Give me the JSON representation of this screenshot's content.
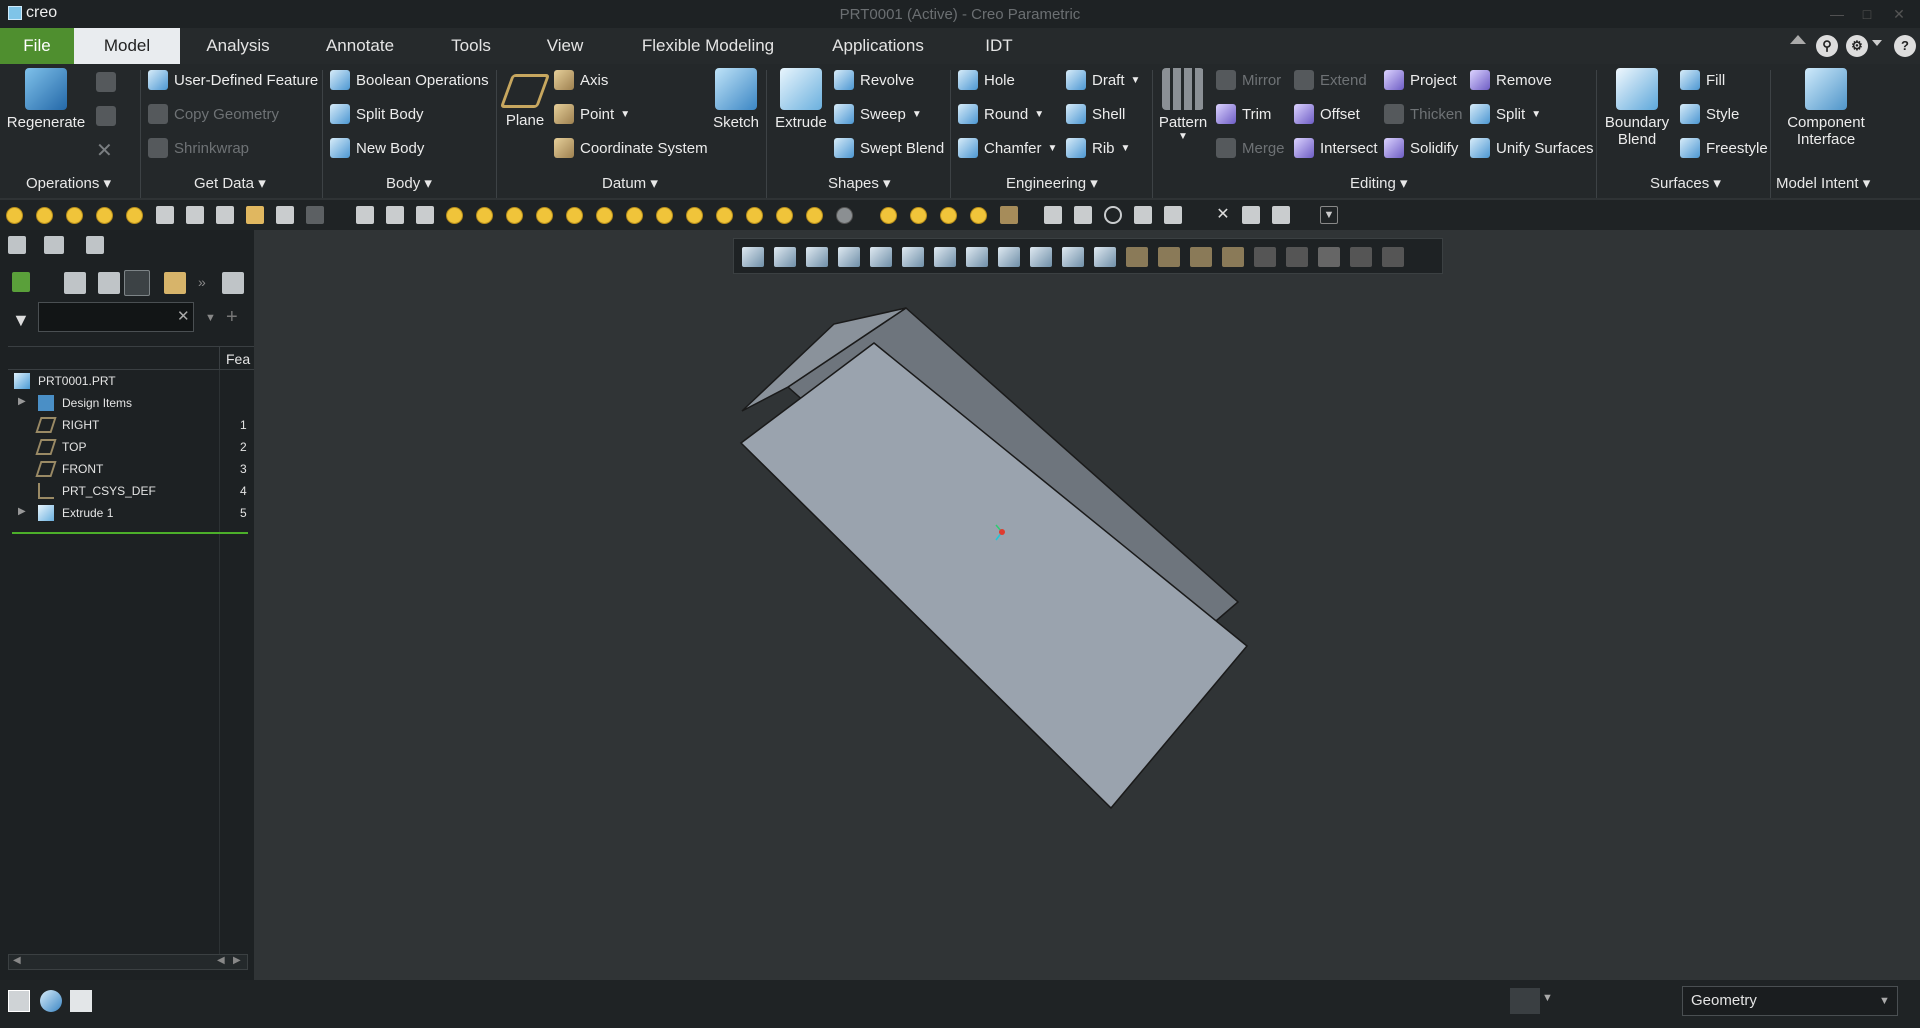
{
  "app": {
    "logo_text": "creo",
    "window_title": "PRT0001 (Active) - Creo Parametric"
  },
  "tabs": {
    "file": "File",
    "model": "Model",
    "analysis": "Analysis",
    "annotate": "Annotate",
    "tools": "Tools",
    "view": "View",
    "flexible_modeling": "Flexible Modeling",
    "applications": "Applications",
    "idt": "IDT"
  },
  "ribbon": {
    "operations": {
      "regenerate": "Regenerate",
      "label": "Operations"
    },
    "get_data": {
      "user_defined_feature": "User-Defined Feature",
      "copy_geometry": "Copy Geometry",
      "shrinkwrap": "Shrinkwrap",
      "label": "Get Data"
    },
    "body": {
      "boolean_operations": "Boolean Operations",
      "split_body": "Split Body",
      "new_body": "New Body",
      "label": "Body"
    },
    "datum": {
      "plane": "Plane",
      "axis": "Axis",
      "point": "Point",
      "coordinate_system": "Coordinate System",
      "sketch": "Sketch",
      "label": "Datum"
    },
    "shapes": {
      "extrude": "Extrude",
      "revolve": "Revolve",
      "sweep": "Sweep",
      "swept_blend": "Swept Blend",
      "label": "Shapes"
    },
    "engineering": {
      "hole": "Hole",
      "round": "Round",
      "chamfer": "Chamfer",
      "draft": "Draft",
      "shell": "Shell",
      "rib": "Rib",
      "label": "Engineering"
    },
    "editing": {
      "pattern": "Pattern",
      "mirror": "Mirror",
      "trim": "Trim",
      "merge": "Merge",
      "extend": "Extend",
      "offset": "Offset",
      "intersect": "Intersect",
      "project": "Project",
      "thicken": "Thicken",
      "solidify": "Solidify",
      "remove": "Remove",
      "split": "Split",
      "unify_surfaces": "Unify Surfaces",
      "label": "Editing"
    },
    "surfaces": {
      "boundary_blend_1": "Boundary",
      "boundary_blend_2": "Blend",
      "fill": "Fill",
      "style": "Style",
      "freestyle": "Freestyle",
      "label": "Surfaces"
    },
    "model_intent": {
      "component_interface_1": "Component",
      "component_interface_2": "Interface",
      "label": "Model Intent"
    }
  },
  "model_tree": {
    "column_header": "Fea",
    "search_placeholder": "",
    "root": "PRT0001.PRT",
    "items": [
      {
        "label": "Design Items",
        "num": "",
        "icon": "design-items-icon"
      },
      {
        "label": "RIGHT",
        "num": "1",
        "icon": "datum-plane-icon"
      },
      {
        "label": "TOP",
        "num": "2",
        "icon": "datum-plane-icon"
      },
      {
        "label": "FRONT",
        "num": "3",
        "icon": "datum-plane-icon"
      },
      {
        "label": "PRT_CSYS_DEF",
        "num": "4",
        "icon": "csys-icon"
      },
      {
        "label": "Extrude 1",
        "num": "5",
        "icon": "extrude-icon"
      }
    ]
  },
  "status": {
    "filter_selection": "Geometry"
  },
  "colors": {
    "file_tab": "#4f8f2f",
    "model_face_light": "#9aa3ae",
    "model_face_dark": "#6e757d",
    "insert_line": "#4caf2a"
  }
}
